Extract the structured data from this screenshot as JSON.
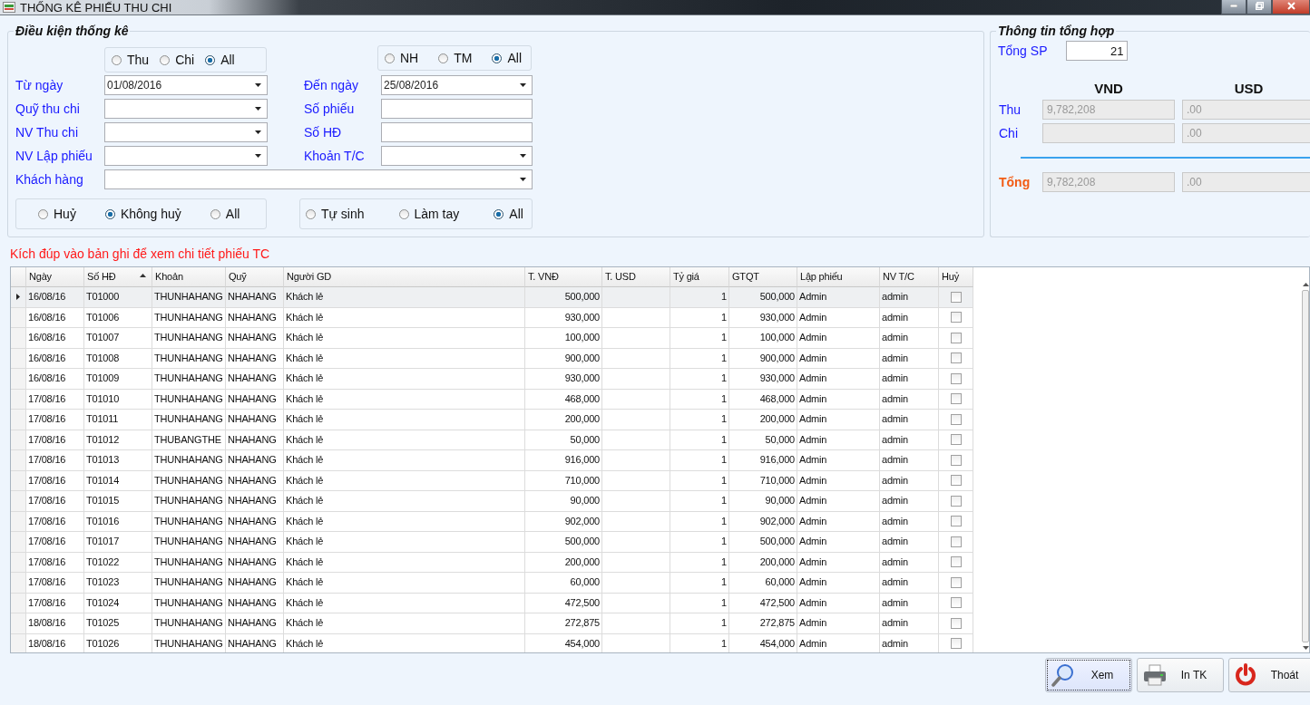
{
  "window": {
    "title": "THỐNG KÊ PHIẾU THU CHI"
  },
  "filter": {
    "title": "Điều kiện thống kê",
    "type_options": [
      {
        "label": "Thu",
        "selected": false
      },
      {
        "label": "Chi",
        "selected": false
      },
      {
        "label": "All",
        "selected": true
      }
    ],
    "pay_options": [
      {
        "label": "NH",
        "selected": false
      },
      {
        "label": "TM",
        "selected": false
      },
      {
        "label": "All",
        "selected": true
      }
    ],
    "fields": [
      {
        "label": "Từ ngày",
        "kind": "combo",
        "value": "01/08/2016"
      },
      {
        "label": "Đến ngày",
        "kind": "combo",
        "value": "25/08/2016"
      },
      {
        "label": "Quỹ thu chi",
        "kind": "combo"
      },
      {
        "label": "Số phiếu",
        "kind": "text"
      },
      {
        "label": "NV Thu chi",
        "kind": "combo"
      },
      {
        "label": "Số HĐ",
        "kind": "text"
      },
      {
        "label": "NV Lập phiếu",
        "kind": "combo"
      },
      {
        "label": "Khoản T/C",
        "kind": "combo"
      }
    ],
    "customer": {
      "label": "Khách hàng",
      "kind": "combo"
    },
    "cancel_options": [
      {
        "label": "Huỷ",
        "selected": false
      },
      {
        "label": "Không huỷ",
        "selected": true
      },
      {
        "label": "All",
        "selected": false
      }
    ],
    "source_options": [
      {
        "label": "Tự sinh",
        "selected": false
      },
      {
        "label": "Làm tay",
        "selected": false
      },
      {
        "label": "All",
        "selected": true
      }
    ]
  },
  "summary": {
    "title": "Thông tin tổng hợp",
    "count_label": "Tổng SP",
    "count": "21",
    "headers": [
      "VND",
      "USD"
    ],
    "rows": [
      {
        "label": "Thu",
        "kind": "normal",
        "vnd": "9,782,208",
        "usd": ".00"
      },
      {
        "label": "Chi",
        "kind": "normal",
        "usd": ".00"
      },
      {
        "label": "Tổng",
        "kind": "total",
        "vnd": "9,782,208",
        "usd": ".00"
      }
    ]
  },
  "hint": "Kích đúp vào bản ghi để xem chi tiết phiếu TC",
  "table": {
    "columns": [
      {
        "label": "Ngày",
        "sorted": false
      },
      {
        "label": "Số HĐ",
        "sorted": true
      },
      {
        "label": "Khoản",
        "sorted": false
      },
      {
        "label": "Quỹ",
        "sorted": false
      },
      {
        "label": "Người GD",
        "sorted": false
      },
      {
        "label": "T. VNĐ",
        "sorted": false
      },
      {
        "label": "T. USD",
        "sorted": false
      },
      {
        "label": "Tỷ giá",
        "sorted": false
      },
      {
        "label": "GTQT",
        "sorted": false
      },
      {
        "label": "Lập phiếu",
        "sorted": false
      },
      {
        "label": "NV T/C",
        "sorted": false
      },
      {
        "label": "Huỷ",
        "sorted": false
      }
    ],
    "rows": [
      {
        "selected": true,
        "date": "16/08/16",
        "invoice": "T01000",
        "account": "THUNHAHANG",
        "fund": "NHAHANG",
        "party": "Khách lẻ",
        "vnd": "500,000",
        "rate": "1",
        "gtqt": "500,000",
        "creator": "Admin",
        "staff": "admin",
        "cancelled": false
      },
      {
        "selected": false,
        "date": "16/08/16",
        "invoice": "T01006",
        "account": "THUNHAHANG",
        "fund": "NHAHANG",
        "party": "Khách lẻ",
        "vnd": "930,000",
        "rate": "1",
        "gtqt": "930,000",
        "creator": "Admin",
        "staff": "admin",
        "cancelled": false
      },
      {
        "selected": false,
        "date": "16/08/16",
        "invoice": "T01007",
        "account": "THUNHAHANG",
        "fund": "NHAHANG",
        "party": "Khách lẻ",
        "vnd": "100,000",
        "rate": "1",
        "gtqt": "100,000",
        "creator": "Admin",
        "staff": "admin",
        "cancelled": false
      },
      {
        "selected": false,
        "date": "16/08/16",
        "invoice": "T01008",
        "account": "THUNHAHANG",
        "fund": "NHAHANG",
        "party": "Khách lẻ",
        "vnd": "900,000",
        "rate": "1",
        "gtqt": "900,000",
        "creator": "Admin",
        "staff": "admin",
        "cancelled": false
      },
      {
        "selected": false,
        "date": "16/08/16",
        "invoice": "T01009",
        "account": "THUNHAHANG",
        "fund": "NHAHANG",
        "party": "Khách lẻ",
        "vnd": "930,000",
        "rate": "1",
        "gtqt": "930,000",
        "creator": "Admin",
        "staff": "admin",
        "cancelled": false
      },
      {
        "selected": false,
        "date": "17/08/16",
        "invoice": "T01010",
        "account": "THUNHAHANG",
        "fund": "NHAHANG",
        "party": "Khách lẻ",
        "vnd": "468,000",
        "rate": "1",
        "gtqt": "468,000",
        "creator": "Admin",
        "staff": "admin",
        "cancelled": false
      },
      {
        "selected": false,
        "date": "17/08/16",
        "invoice": "T01011",
        "account": "THUNHAHANG",
        "fund": "NHAHANG",
        "party": "Khách lẻ",
        "vnd": "200,000",
        "rate": "1",
        "gtqt": "200,000",
        "creator": "Admin",
        "staff": "admin",
        "cancelled": false
      },
      {
        "selected": false,
        "date": "17/08/16",
        "invoice": "T01012",
        "account": "THUBANGTHE",
        "fund": "NHAHANG",
        "party": "Khách lẻ",
        "vnd": "50,000",
        "rate": "1",
        "gtqt": "50,000",
        "creator": "Admin",
        "staff": "admin",
        "cancelled": false
      },
      {
        "selected": false,
        "date": "17/08/16",
        "invoice": "T01013",
        "account": "THUNHAHANG",
        "fund": "NHAHANG",
        "party": "Khách lẻ",
        "vnd": "916,000",
        "rate": "1",
        "gtqt": "916,000",
        "creator": "Admin",
        "staff": "admin",
        "cancelled": false
      },
      {
        "selected": false,
        "date": "17/08/16",
        "invoice": "T01014",
        "account": "THUNHAHANG",
        "fund": "NHAHANG",
        "party": "Khách lẻ",
        "vnd": "710,000",
        "rate": "1",
        "gtqt": "710,000",
        "creator": "Admin",
        "staff": "admin",
        "cancelled": false
      },
      {
        "selected": false,
        "date": "17/08/16",
        "invoice": "T01015",
        "account": "THUNHAHANG",
        "fund": "NHAHANG",
        "party": "Khách lẻ",
        "vnd": "90,000",
        "rate": "1",
        "gtqt": "90,000",
        "creator": "Admin",
        "staff": "admin",
        "cancelled": false
      },
      {
        "selected": false,
        "date": "17/08/16",
        "invoice": "T01016",
        "account": "THUNHAHANG",
        "fund": "NHAHANG",
        "party": "Khách lẻ",
        "vnd": "902,000",
        "rate": "1",
        "gtqt": "902,000",
        "creator": "Admin",
        "staff": "admin",
        "cancelled": false
      },
      {
        "selected": false,
        "date": "17/08/16",
        "invoice": "T01017",
        "account": "THUNHAHANG",
        "fund": "NHAHANG",
        "party": "Khách lẻ",
        "vnd": "500,000",
        "rate": "1",
        "gtqt": "500,000",
        "creator": "Admin",
        "staff": "admin",
        "cancelled": false
      },
      {
        "selected": false,
        "date": "17/08/16",
        "invoice": "T01022",
        "account": "THUNHAHANG",
        "fund": "NHAHANG",
        "party": "Khách lẻ",
        "vnd": "200,000",
        "rate": "1",
        "gtqt": "200,000",
        "creator": "Admin",
        "staff": "admin",
        "cancelled": false
      },
      {
        "selected": false,
        "date": "17/08/16",
        "invoice": "T01023",
        "account": "THUNHAHANG",
        "fund": "NHAHANG",
        "party": "Khách lẻ",
        "vnd": "60,000",
        "rate": "1",
        "gtqt": "60,000",
        "creator": "Admin",
        "staff": "admin",
        "cancelled": false
      },
      {
        "selected": false,
        "date": "17/08/16",
        "invoice": "T01024",
        "account": "THUNHAHANG",
        "fund": "NHAHANG",
        "party": "Khách lẻ",
        "vnd": "472,500",
        "rate": "1",
        "gtqt": "472,500",
        "creator": "Admin",
        "staff": "admin",
        "cancelled": false
      },
      {
        "selected": false,
        "date": "18/08/16",
        "invoice": "T01025",
        "account": "THUNHAHANG",
        "fund": "NHAHANG",
        "party": "Khách lẻ",
        "vnd": "272,875",
        "rate": "1",
        "gtqt": "272,875",
        "creator": "Admin",
        "staff": "admin",
        "cancelled": false
      },
      {
        "selected": false,
        "date": "18/08/16",
        "invoice": "T01026",
        "account": "THUNHAHANG",
        "fund": "NHAHANG",
        "party": "Khách lẻ",
        "vnd": "454,000",
        "rate": "1",
        "gtqt": "454,000",
        "creator": "Admin",
        "staff": "admin",
        "cancelled": false
      }
    ]
  },
  "buttons": [
    {
      "label": "Xem",
      "kind": "view",
      "focused": true
    },
    {
      "label": "In TK",
      "kind": "print",
      "focused": false
    },
    {
      "label": "Thoát",
      "kind": "exit",
      "focused": false
    }
  ]
}
